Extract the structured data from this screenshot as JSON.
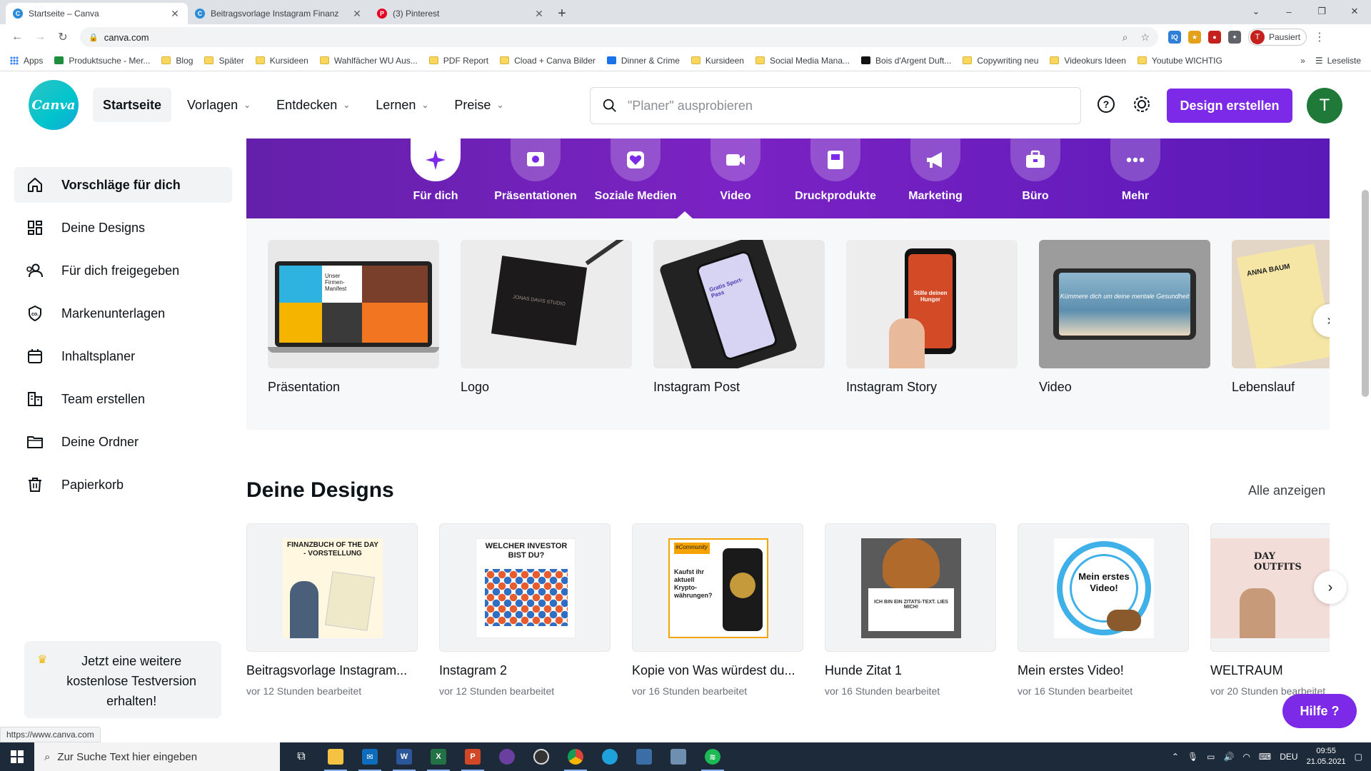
{
  "browser": {
    "tabs": [
      {
        "title": "Startseite – Canva",
        "active": true,
        "favicon": "canva-favicon",
        "color": "#2a8bd8"
      },
      {
        "title": "Beitragsvorlage Instagram Finanz",
        "active": false,
        "favicon": "canva-favicon",
        "color": "#2a8bd8"
      },
      {
        "title": "(3) Pinterest",
        "active": false,
        "favicon": "pinterest-favicon",
        "color": "#e60023"
      }
    ],
    "address": "canva.com",
    "profile_status": "Pausiert",
    "profile_initial": "T",
    "bookmarks": [
      {
        "label": "Apps",
        "icon": "apps-grid-icon"
      },
      {
        "label": "Produktsuche - Mer...",
        "icon": "site-icon"
      },
      {
        "label": "Blog",
        "icon": "folder-icon"
      },
      {
        "label": "Später",
        "icon": "folder-icon"
      },
      {
        "label": "Kursideen",
        "icon": "folder-icon"
      },
      {
        "label": "Wahlfächer WU Aus...",
        "icon": "folder-icon"
      },
      {
        "label": "PDF Report",
        "icon": "folder-icon"
      },
      {
        "label": "Cload + Canva Bilder",
        "icon": "folder-icon"
      },
      {
        "label": "Dinner & Crime",
        "icon": "site-icon"
      },
      {
        "label": "Kursideen",
        "icon": "folder-icon"
      },
      {
        "label": "Social Media Mana...",
        "icon": "folder-icon"
      },
      {
        "label": "Bois d'Argent Duft...",
        "icon": "site-icon"
      },
      {
        "label": "Copywriting neu",
        "icon": "folder-icon"
      },
      {
        "label": "Videokurs Ideen",
        "icon": "folder-icon"
      },
      {
        "label": "Youtube WICHTIG",
        "icon": "folder-icon"
      }
    ],
    "reading_list": "Leseliste",
    "more": "»",
    "status_url": "https://www.canva.com"
  },
  "header": {
    "logo_text": "Canva",
    "nav": [
      {
        "label": "Startseite",
        "active": true,
        "dropdown": false
      },
      {
        "label": "Vorlagen",
        "active": false,
        "dropdown": true
      },
      {
        "label": "Entdecken",
        "active": false,
        "dropdown": true
      },
      {
        "label": "Lernen",
        "active": false,
        "dropdown": true
      },
      {
        "label": "Preise",
        "active": false,
        "dropdown": true
      }
    ],
    "search_placeholder": "\"Planer\" ausprobieren",
    "create_button": "Design erstellen",
    "avatar_initial": "T"
  },
  "sidebar": {
    "items": [
      {
        "label": "Vorschläge für dich",
        "icon": "home-icon",
        "active": true
      },
      {
        "label": "Deine Designs",
        "icon": "grid-icon",
        "active": false
      },
      {
        "label": "Für dich freigegeben",
        "icon": "people-icon",
        "active": false
      },
      {
        "label": "Markenunterlagen",
        "icon": "brand-kit-icon",
        "active": false
      },
      {
        "label": "Inhaltsplaner",
        "icon": "calendar-icon",
        "active": false
      },
      {
        "label": "Team erstellen",
        "icon": "team-icon",
        "active": false
      },
      {
        "label": "Deine Ordner",
        "icon": "folder-icon",
        "active": false
      },
      {
        "label": "Papierkorb",
        "icon": "trash-icon",
        "active": false
      }
    ],
    "promo": "Jetzt eine weitere kostenlose Testversion erhalten!"
  },
  "categories": [
    {
      "label": "Für dich",
      "icon": "sparkle-icon",
      "active": true
    },
    {
      "label": "Präsentationen",
      "icon": "presentation-icon",
      "active": false
    },
    {
      "label": "Soziale Medien",
      "icon": "heart-icon",
      "active": false
    },
    {
      "label": "Video",
      "icon": "video-camera-icon",
      "active": false
    },
    {
      "label": "Druckprodukte",
      "icon": "print-icon",
      "active": false
    },
    {
      "label": "Marketing",
      "icon": "megaphone-icon",
      "active": false
    },
    {
      "label": "Büro",
      "icon": "briefcase-icon",
      "active": false
    },
    {
      "label": "Mehr",
      "icon": "more-dots-icon",
      "active": false
    }
  ],
  "design_types": [
    {
      "label": "Präsentation",
      "thumb_text": "Unser Firmen-Manifest"
    },
    {
      "label": "Logo",
      "thumb_text": "JONAS DAVIS STUDIO"
    },
    {
      "label": "Instagram Post",
      "thumb_text": "Gratis Sport-Pass"
    },
    {
      "label": "Instagram Story",
      "thumb_text": "Stille deinen Hunger"
    },
    {
      "label": "Video",
      "thumb_text": "Kümmere dich um deine mentale Gesundheit"
    },
    {
      "label": "Lebenslauf",
      "thumb_text": "ANNA BAUM"
    }
  ],
  "designs_section": {
    "title": "Deine Designs",
    "see_all": "Alle anzeigen",
    "items": [
      {
        "title": "Beitragsvorlage Instagram...",
        "meta": "vor 12 Stunden bearbeitet",
        "thumb_text": "FINANZBUCH OF THE DAY - VORSTELLUNG"
      },
      {
        "title": "Instagram 2",
        "meta": "vor 12 Stunden bearbeitet",
        "thumb_text": "WELCHER INVESTOR BIST DU?"
      },
      {
        "title": "Kopie von Was würdest du...",
        "meta": "vor 16 Stunden bearbeitet",
        "thumb_text": "Kaufst ihr aktuell Krypto-währungen?"
      },
      {
        "title": "Hunde Zitat 1",
        "meta": "vor 16 Stunden bearbeitet",
        "thumb_text": "ICH BIN EIN ZITATS-TEXT. LIES MICH!"
      },
      {
        "title": "Mein erstes Video!",
        "meta": "vor 16 Stunden bearbeitet",
        "thumb_text": "Mein erstes Video!"
      },
      {
        "title": "WELTRAUM",
        "meta": "vor 20 Stunden bearbeitet",
        "thumb_text": "DAY OUTFITS"
      }
    ]
  },
  "help_button": "Hilfe ?",
  "taskbar": {
    "search_placeholder": "Zur Suche Text hier eingeben",
    "language": "DEU",
    "time": "09:55",
    "date": "21.05.2021"
  },
  "colors": {
    "brand_purple": "#7d2ae8",
    "banner_purple": "#6d20bb",
    "canva_teal": "#00c4cc",
    "avatar_green": "#1f7a39"
  }
}
